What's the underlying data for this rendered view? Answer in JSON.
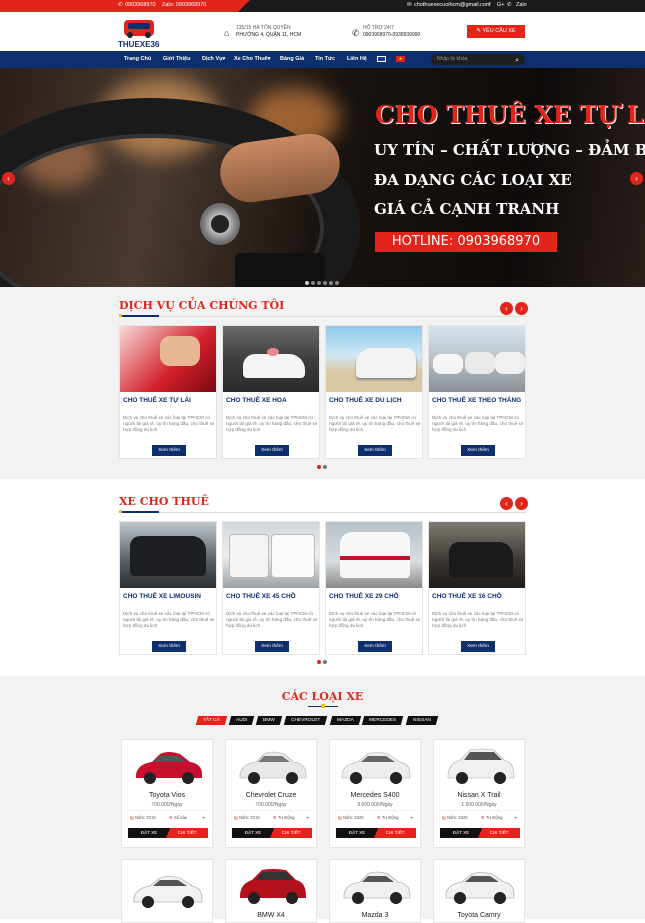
{
  "topbar": {
    "phone": "0903968970",
    "zalo": "Zalo: 0903968970",
    "email": "chothuexecuoihcm@gmail.com",
    "social_fb": "f",
    "social_g": "G+",
    "zalo_label": "Zalo"
  },
  "header": {
    "logo_text": "THUEXE365",
    "address_line1": "135/15 HÀ TÔN QUYỀN",
    "address_line2": "PHƯỜNG 4, QUẬN 11, HCM",
    "support_label": "HỖ TRỢ 24/7",
    "support_phones": "0903968970-0938939990",
    "request_button": "YÊU CẦU XE"
  },
  "nav": {
    "items": [
      "Trang Chủ",
      "Giới Thiệu",
      "Dịch Vụ",
      "Xe Cho Thuê",
      "Bảng Giá",
      "Tin Tức",
      "Liên Hệ"
    ],
    "search_placeholder": "Nhập từ khóa"
  },
  "banner": {
    "line1": "CHO THUÊ XE TỰ LÁI",
    "line2": "UY TÍN – CHẤT LƯỢNG – ĐẢM BẢO",
    "line3": "ĐA DẠNG CÁC LOẠI XE",
    "line4": "GIÁ CẢ CẠNH TRANH",
    "hotline": "HOTLINE: 0903968970"
  },
  "services": {
    "title": "DỊCH VỤ CỦA CHÚNG TÔI",
    "cards": [
      {
        "title": "CHO THUÊ XE TỰ LÁI",
        "desc": "Dịch vụ cho thuê xe các loại tại TPHCM có người lái giá rẻ, uy tín hàng đầu, cho thuê xe hợp đồng du lịch",
        "button": "Xem thêm"
      },
      {
        "title": "CHO THUÊ XE HOA",
        "desc": "Dịch vụ cho thuê xe các loại tại TPHCM có người lái giá rẻ, uy tín hàng đầu, cho thuê xe hợp đồng du lịch",
        "button": "Xem thêm"
      },
      {
        "title": "CHO THUÊ XE DU LỊCH",
        "desc": "Dịch vụ cho thuê xe các loại tại TPHCM có người lái giá rẻ, uy tín hàng đầu, cho thuê xe hợp đồng du lịch",
        "button": "Xem thêm"
      },
      {
        "title": "CHO THUÊ XE THEO THÁNG",
        "desc": "Dịch vụ cho thuê xe các loại tại TPHCM có người lái giá rẻ, uy tín hàng đầu, cho thuê xe hợp đồng du lịch",
        "button": "Xem thêm"
      }
    ]
  },
  "rentals": {
    "title": "XE CHO THUÊ",
    "cards": [
      {
        "title": "CHO THUÊ XE LIMOUSIN",
        "desc": "Dịch vụ cho thuê xe các loại tại TPHCM có người lái giá rẻ, uy tín hàng đầu, cho thuê xe hợp đồng du lịch",
        "button": "Xem thêm"
      },
      {
        "title": "CHO THUÊ XE 45 CHỖ",
        "desc": "Dịch vụ cho thuê xe các loại tại TPHCM có người lái giá rẻ, uy tín hàng đầu, cho thuê xe hợp đồng du lịch",
        "button": "Xem thêm"
      },
      {
        "title": "CHO THUÊ XE 29 CHỖ",
        "desc": "Dịch vụ cho thuê xe các loại tại TPHCM có người lái giá rẻ, uy tín hàng đầu, cho thuê xe hợp đồng du lịch",
        "button": "Xem thêm"
      },
      {
        "title": "CHO THUÊ XE 16 CHỖ",
        "desc": "Dịch vụ cho thuê xe các loại tại TPHCM có người lái giá rẻ, uy tín hàng đầu, cho thuê xe hợp đồng du lịch",
        "button": "Xem thêm"
      }
    ]
  },
  "car_types": {
    "title": "CÁC LOẠI XE",
    "tabs": [
      "TẤT CẢ",
      "AUDI",
      "BMW",
      "CHEVROLET",
      "MAZDA",
      "MERCEDES",
      "NISSAN"
    ],
    "cars": [
      {
        "name": "Toyota Vios",
        "price": "700.000/Ngày",
        "year": "Năm: 2019",
        "trans": "Số sàn",
        "btn1": "ĐẶT XE",
        "btn2": "CHI TIẾT",
        "color": "#c8102e"
      },
      {
        "name": "Chevrolet Cruze",
        "price": "700.000/Ngày",
        "year": "Năm: 2019",
        "trans": "Tự Động",
        "btn1": "ĐẶT XE",
        "btn2": "CHI TIẾT",
        "color": "#e8e8e8"
      },
      {
        "name": "Mercedes S400",
        "price": "9.000.000/Ngày",
        "year": "Năm: 2020",
        "trans": "Tự Động",
        "btn1": "ĐẶT XE",
        "btn2": "CHI TIẾT",
        "color": "#eeeeee"
      },
      {
        "name": "Nissan X Trail",
        "price": "1.500.000/Ngày",
        "year": "Năm: 2020",
        "trans": "Tự Động",
        "btn1": "ĐẶT XE",
        "btn2": "CHI TIẾT",
        "color": "#f0f0f0"
      }
    ],
    "cars_row2": [
      {
        "name": "",
        "color": "#f2f2f2"
      },
      {
        "name": "BMW X4",
        "color": "#b3121c"
      },
      {
        "name": "Mazda 3",
        "color": "#f0f0f0"
      },
      {
        "name": "Toyota Camry",
        "color": "#f0f0f0"
      }
    ]
  }
}
